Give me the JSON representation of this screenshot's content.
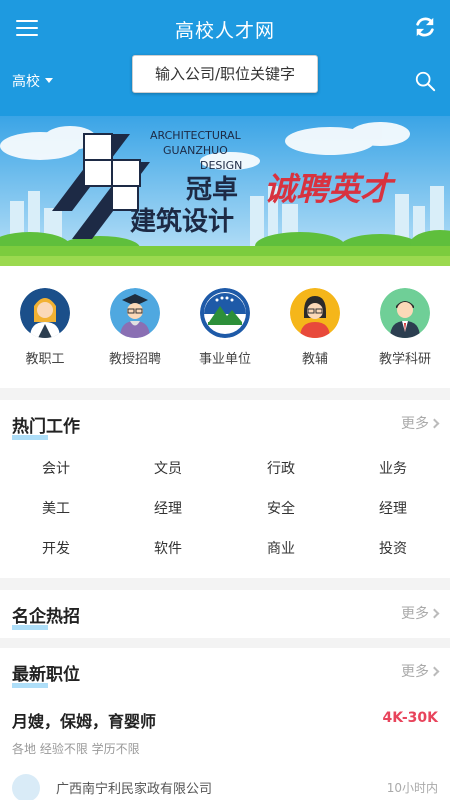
{
  "header": {
    "title": "高校人才网",
    "region": "高校",
    "search_placeholder": "输入公司/职位关键字",
    "colors": {
      "brand": "#1e9ae0"
    }
  },
  "banner": {
    "text_en_1": "ARCHITECTURAL",
    "text_en_2": "GUANZHUO",
    "text_en_3": "DESIGN",
    "brand_cn_1": "冠卓",
    "brand_cn_2": "建筑设计",
    "slogan": "诚聘英才"
  },
  "categories": [
    {
      "label": "教职工",
      "icon": "female-staff-icon"
    },
    {
      "label": "教授招聘",
      "icon": "professor-icon"
    },
    {
      "label": "事业单位",
      "icon": "institution-emblem-icon"
    },
    {
      "label": "教辅",
      "icon": "assistant-icon"
    },
    {
      "label": "教学科研",
      "icon": "researcher-icon"
    }
  ],
  "hot_jobs": {
    "title": "热门工作",
    "more": "更多",
    "tags": [
      "会计",
      "文员",
      "行政",
      "业务",
      "美工",
      "经理",
      "安全",
      "经理",
      "开发",
      "软件",
      "商业",
      "投资"
    ]
  },
  "famous_companies": {
    "title": "名企热招",
    "more": "更多"
  },
  "latest": {
    "title": "最新职位",
    "more": "更多",
    "post": {
      "title": "月嫂，保姆，育婴师",
      "salary": "4K-30K",
      "meta": "各地 经验不限 学历不限",
      "company": "广西南宁利民家政有限公司",
      "time": "10小时内"
    }
  }
}
